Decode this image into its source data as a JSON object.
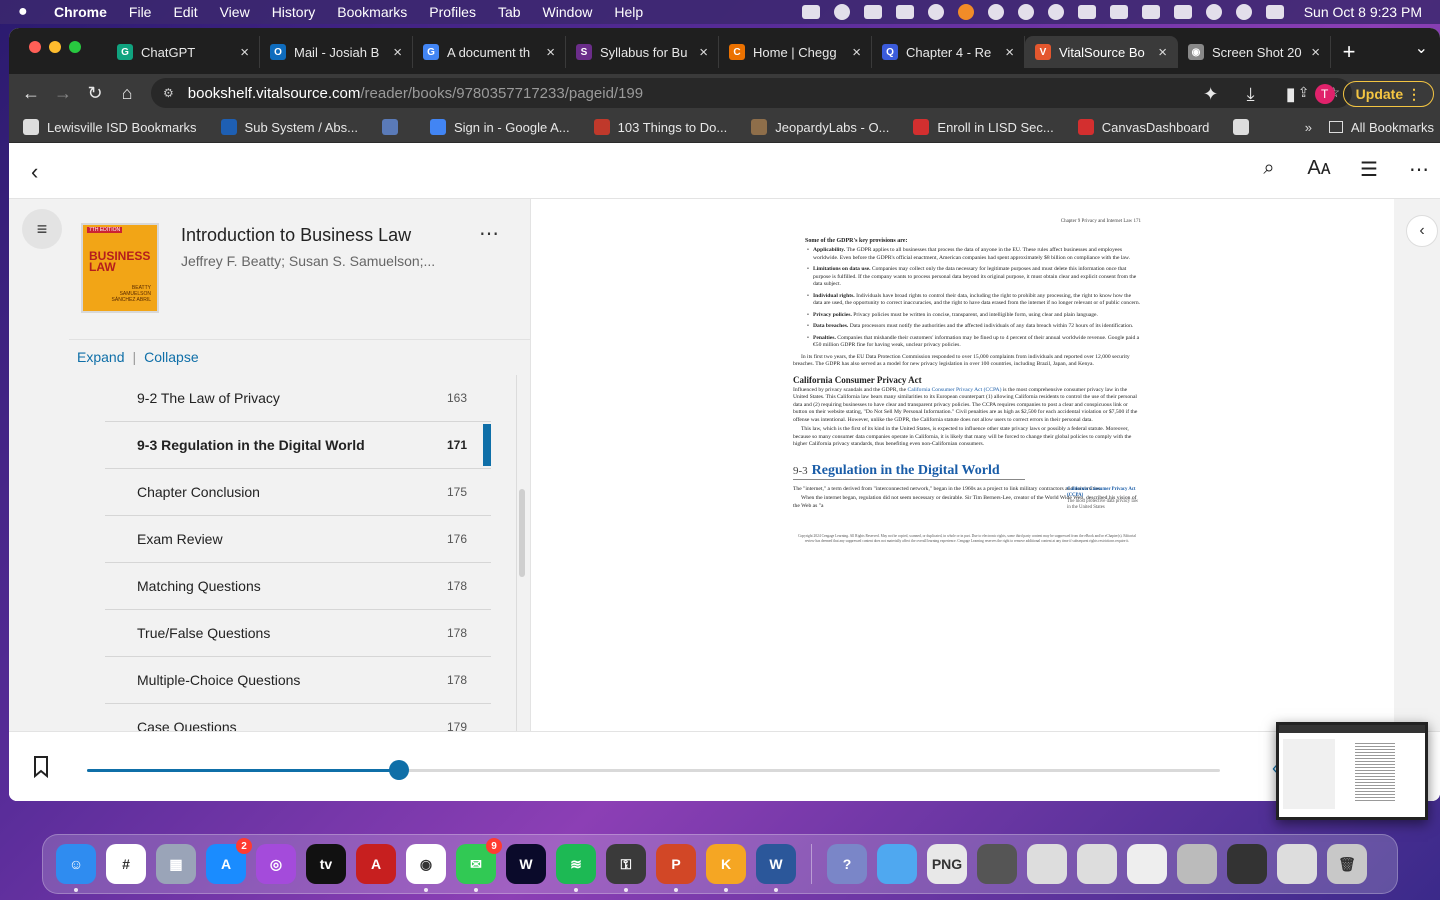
{
  "menubar": {
    "app_name": "Chrome",
    "items": [
      "File",
      "Edit",
      "View",
      "History",
      "Bookmarks",
      "Profiles",
      "Tab",
      "Window",
      "Help"
    ],
    "clock": "Sun Oct 8  9:23 PM"
  },
  "tabs": [
    {
      "title": "ChatGPT",
      "color": "#10a37f",
      "glyph": "G"
    },
    {
      "title": "Mail - Josiah B",
      "color": "#0f6cbd",
      "glyph": "O"
    },
    {
      "title": "A document th",
      "color": "#4285f4",
      "glyph": "G"
    },
    {
      "title": "Syllabus for Bu",
      "color": "#6b2d8a",
      "glyph": "S"
    },
    {
      "title": "Home | Chegg",
      "color": "#eb7100",
      "glyph": "C"
    },
    {
      "title": "Chapter 4 - Re",
      "color": "#3b5bdb",
      "glyph": "Q"
    },
    {
      "title": "VitalSource Bo",
      "color": "#e4572e",
      "glyph": "V"
    },
    {
      "title": "Screen Shot 20",
      "color": "#888888",
      "glyph": "◉"
    }
  ],
  "omnibox": {
    "host": "bookshelf.vitalsource.com",
    "path": "/reader/books/9780357717233/pageid/199"
  },
  "toolbar": {
    "profile_initial": "T",
    "update_label": "Update"
  },
  "bookmarks": {
    "items": [
      {
        "label": "Lewisville ISD Bookmarks",
        "color": "#dddddd"
      },
      {
        "label": "Sub System / Abs...",
        "color": "#1e5fb3"
      },
      {
        "label": "",
        "color": "#5a7ab8"
      },
      {
        "label": "Sign in - Google A...",
        "color": "#4285f4"
      },
      {
        "label": "103 Things to Do...",
        "color": "#c0392b"
      },
      {
        "label": "JeopardyLabs - O...",
        "color": "#8e6e4a"
      },
      {
        "label": "Enroll in LISD Sec...",
        "color": "#d32f2f"
      },
      {
        "label": "CanvasDashboard",
        "color": "#d32f2f"
      },
      {
        "label": "",
        "color": "#dddddd"
      }
    ],
    "more": "»",
    "all_label": "All Bookmarks"
  },
  "book": {
    "title": "Introduction to Business Law",
    "authors": "Jeffrey F. Beatty; Susan S. Samuelson;...",
    "cover_title": "BUSINESS LAW",
    "cover_edition": "7TH EDITION",
    "cover_authors": "BEATTY\nSAMUELSON\nSÁNCHEZ ABRIL"
  },
  "toc": {
    "expand_label": "Expand",
    "separator": "|",
    "collapse_label": "Collapse",
    "items": [
      {
        "label": "9-2 The Law of Privacy",
        "page": "163",
        "current": false
      },
      {
        "label": "9-3 Regulation in the Digital World",
        "page": "171",
        "current": true
      },
      {
        "label": "Chapter Conclusion",
        "page": "175",
        "current": false
      },
      {
        "label": "Exam Review",
        "page": "176",
        "current": false
      },
      {
        "label": "Matching Questions",
        "page": "178",
        "current": false
      },
      {
        "label": "True/False Questions",
        "page": "178",
        "current": false
      },
      {
        "label": "Multiple-Choice Questions",
        "page": "178",
        "current": false
      },
      {
        "label": "Case Questions",
        "page": "179",
        "current": false
      }
    ]
  },
  "page": {
    "running_head": "Chapter 9    Privacy and Internet Law         171",
    "key_provisions_heading": "Some of the GDPR's key provisions are:",
    "bullets": [
      {
        "term": "Applicability.",
        "text": "The GDPR applies to all businesses that process the data of anyone in the EU. These rules affect businesses and employees worldwide. Even before the GDPR's official enactment, American companies had spent approximately $8 billion on compliance with the law."
      },
      {
        "term": "Limitations on data use.",
        "text": "Companies may collect only the data necessary for legitimate purposes and must delete this information once that purpose is fulfilled. If the company wants to process personal data beyond its original purpose, it must obtain clear and explicit consent from the data subject."
      },
      {
        "term": "Individual rights.",
        "text": "Individuals have broad rights to control their data, including the right to prohibit any processing, the right to know how the data are used, the opportunity to correct inaccuracies, and the right to have data erased from the internet if no longer relevant or of public concern."
      },
      {
        "term": "Privacy policies.",
        "text": "Privacy policies must be written in concise, transparent, and intelligible form, using clear and plain language."
      },
      {
        "term": "Data breaches.",
        "text": "Data processors must notify the authorities and the affected individuals of any data breach within 72 hours of its identification."
      },
      {
        "term": "Penalties.",
        "text": "Companies that mishandle their customers' information may be fined up to 4 percent of their annual worldwide revenue. Google paid a €50 million GDPR fine for having weak, unclear privacy policies."
      }
    ],
    "para1": "In its first two years, the EU Data Protection Commission responded to over 15,000 complaints from individuals and reported over 12,000 security breaches. The GDPR has also served as a model for new privacy legislation in over 100 countries, including Brazil, Japan, and Kenya.",
    "ccpa_heading": "California Consumer Privacy Act",
    "ccpa_intro": "Influenced by privacy scandals and the GDPR, the",
    "ccpa_link": "California Consumer Privacy Act (CCPA)",
    "ccpa_body": "is the most comprehensive consumer privacy law in the United States. This California law bears many similarities to its European counterpart (1) allowing California residents to control the use of their personal data and (2) requiring businesses to have clear and transparent privacy policies. The CCPA requires companies to post a clear and conspicuous link or button on their website stating, \"Do Not Sell My Personal Information.\" Civil penalties are as high as $2,500 for each accidental violation or $7,500 if the offense was intentional. However, unlike the GDPR, the California statute does not allow users to correct errors in their personal data.",
    "para2": "This law, which is the first of its kind in the United States, is expected to influence other state privacy laws or possibly a federal statute. Moreover, because so many consumer data companies operate in California, it is likely that many will be forced to change their global policies to comply with the higher California privacy standards, thus benefiting even non-Californian consumers.",
    "margin_term": "California Consumer Privacy Act (CCPA)",
    "margin_def": "The most protective data privacy law in the United States",
    "section_num": "9-3",
    "section_title": "Regulation in the Digital World",
    "para3": "The \"internet,\" a term derived from \"interconnected network,\" began in the 1960s as a project to link military contractors and universities.",
    "para4": "When the internet began, regulation did not seem necessary or desirable. Sir Tim Berners-Lee, creator of the World Wide Web, described his vision of the Web as \"a",
    "footer": "Copyright 2024 Cengage Learning. All Rights Reserved. May not be copied, scanned, or duplicated, in whole or in part. Due to electronic rights, some third party content may be suppressed from the eBook and/or eChapter(s). Editorial review has deemed that any suppressed content does not materially affect the overall learning experience. Cengage Learning reserves the right to remove additional content at any time if subsequent rights restrictions require it."
  },
  "progress": {
    "fraction": 0.275
  },
  "dock": {
    "apps": [
      {
        "name": "finder",
        "color": "#2f8cf0",
        "glyph": "☺",
        "running": true,
        "badge": ""
      },
      {
        "name": "slack",
        "color": "#ffffff",
        "glyph": "#",
        "running": false,
        "badge": ""
      },
      {
        "name": "launchpad",
        "color": "#9aa4b8",
        "glyph": "▦",
        "running": false,
        "badge": ""
      },
      {
        "name": "app-store",
        "color": "#1a8cff",
        "glyph": "A",
        "running": false,
        "badge": "2"
      },
      {
        "name": "podcasts",
        "color": "#a44bdb",
        "glyph": "◎",
        "running": false,
        "badge": ""
      },
      {
        "name": "apple-tv",
        "color": "#111111",
        "glyph": "tv",
        "running": false,
        "badge": ""
      },
      {
        "name": "acrobat",
        "color": "#c71f1f",
        "glyph": "A",
        "running": false,
        "badge": ""
      },
      {
        "name": "chrome",
        "color": "#ffffff",
        "glyph": "◉",
        "running": true,
        "badge": ""
      },
      {
        "name": "messages",
        "color": "#31c954",
        "glyph": "✉",
        "running": true,
        "badge": "9"
      },
      {
        "name": "webex",
        "color": "#0a0a2a",
        "glyph": "W",
        "running": false,
        "badge": ""
      },
      {
        "name": "spotify",
        "color": "#1db954",
        "glyph": "≋",
        "running": true,
        "badge": ""
      },
      {
        "name": "keychain",
        "color": "#3a3a3a",
        "glyph": "⚿",
        "running": true,
        "badge": ""
      },
      {
        "name": "powerpoint",
        "color": "#d24726",
        "glyph": "P",
        "running": true,
        "badge": ""
      },
      {
        "name": "keynote",
        "color": "#f5a623",
        "glyph": "K",
        "running": true,
        "badge": ""
      },
      {
        "name": "word",
        "color": "#2b579a",
        "glyph": "W",
        "running": true,
        "badge": ""
      }
    ],
    "recent": [
      {
        "name": "help",
        "color": "#7a86c8",
        "glyph": "?"
      },
      {
        "name": "folder",
        "color": "#4fa8f0",
        "glyph": ""
      },
      {
        "name": "png-file",
        "color": "#e8e8e8",
        "glyph": "PNG"
      },
      {
        "name": "window-1",
        "color": "#555555",
        "glyph": ""
      },
      {
        "name": "window-2",
        "color": "#dddddd",
        "glyph": ""
      },
      {
        "name": "window-3",
        "color": "#dddddd",
        "glyph": ""
      },
      {
        "name": "window-4",
        "color": "#eeeeee",
        "glyph": ""
      },
      {
        "name": "window-5",
        "color": "#bbbbbb",
        "glyph": ""
      },
      {
        "name": "window-6",
        "color": "#333333",
        "glyph": ""
      },
      {
        "name": "window-7",
        "color": "#dddddd",
        "glyph": ""
      },
      {
        "name": "trash",
        "color": "#c8c8c8",
        "glyph": "🗑"
      }
    ]
  }
}
